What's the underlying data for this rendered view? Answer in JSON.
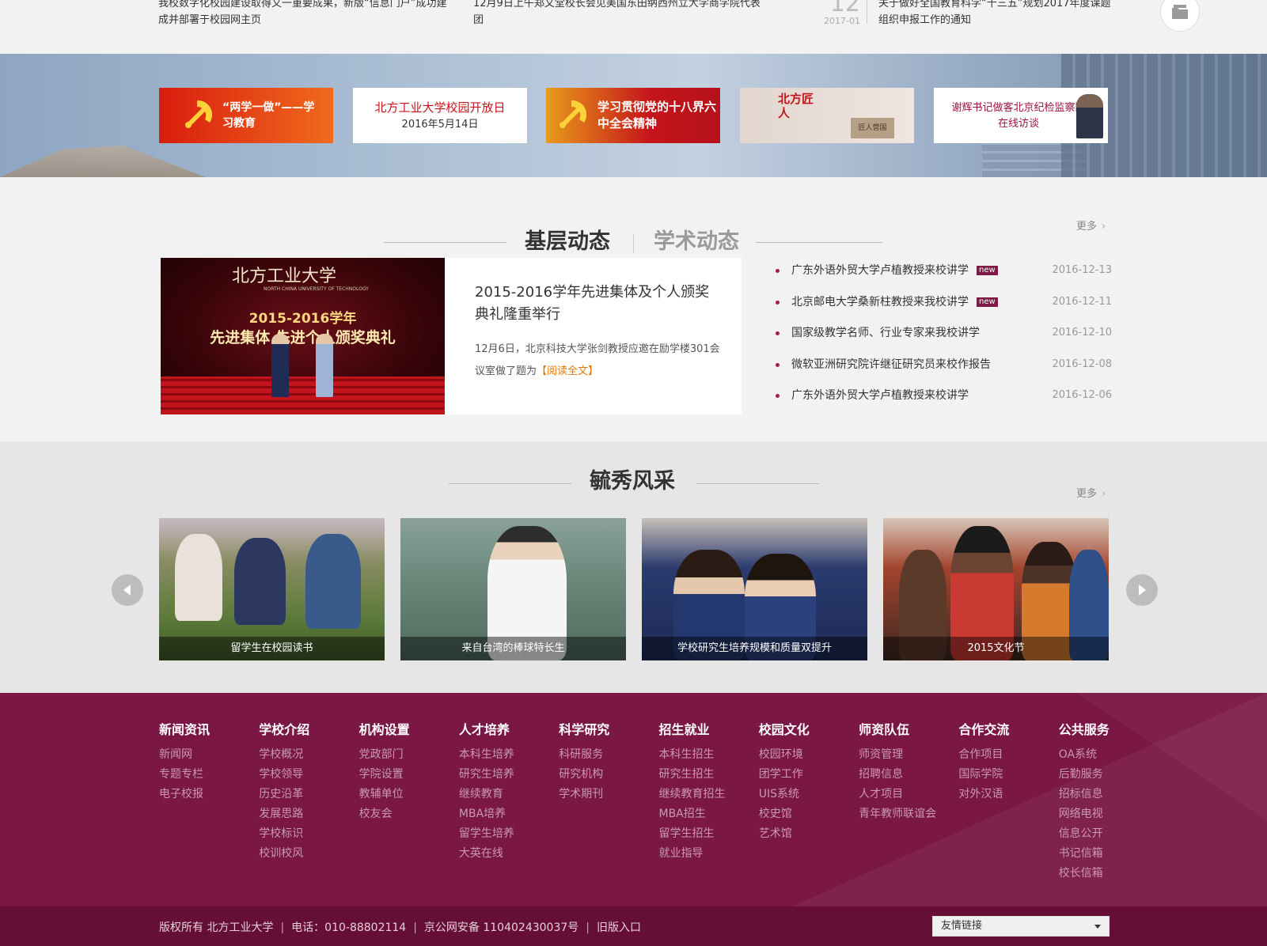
{
  "top_news": {
    "item1": "我校数字化校园建设取得又一重要成果，新版“信息门户”成功建成并部署于校园网主页",
    "item2": "12月9日上午郑文堂校长会见美国东田纳西州立大学商学院代表团",
    "date_day": "12",
    "date_ym": "2017-01",
    "item3": "关于做好全国教育科学“十三五”规划2017年度课题组织申报工作的通知"
  },
  "banners": [
    {
      "text": "“两学一做”——学习教育"
    },
    {
      "title": "北方工业大学校园开放日",
      "sub": "2016年5月14日"
    },
    {
      "text": "学习贯彻党的十八界六中全会精神"
    },
    {
      "text": "北方匠人",
      "stamp": "匠人营国"
    },
    {
      "text": "谢辉书记做客北京纪检监察网在线访谈"
    }
  ],
  "section1": {
    "tab_active": "基层动态",
    "tab_inactive": "学术动态",
    "more": "更多",
    "feature": {
      "image_uni": "北方工业大学",
      "image_uni_en": "NORTH CHINA UNIVERSITY OF TECHNOLOGY",
      "image_line1": "2015-2016学年",
      "image_line2": "先进集体  先进个人颁奖典礼",
      "title": "2015-2016学年先进集体及个人颁奖典礼隆重举行",
      "summary": "12月6日，北京科技大学张剑教授应邀在励学楼301会议室做了题为",
      "read_more": "【阅读全文】"
    },
    "news": [
      {
        "title": "广东外语外贸大学卢植教授来校讲学",
        "badge": "new",
        "date": "2016-12-13"
      },
      {
        "title": "北京邮电大学桑新柱教授来我校讲学",
        "badge": "new",
        "date": "2016-12-11"
      },
      {
        "title": "国家级教学名师、行业专家来我校讲学",
        "badge": "",
        "date": "2016-12-10"
      },
      {
        "title": "微软亚洲研究院许继征研究员来校作报告",
        "badge": "",
        "date": "2016-12-08"
      },
      {
        "title": "广东外语外贸大学卢植教授来校讲学",
        "badge": "",
        "date": "2016-12-06"
      }
    ]
  },
  "section2": {
    "title": "毓秀风采",
    "more": "更多",
    "photos": [
      {
        "caption": "留学生在校园读书"
      },
      {
        "caption": "来自台湾的棒球特长生"
      },
      {
        "caption": "学校研究生培养规模和质量双提升"
      },
      {
        "caption": "2015文化节"
      }
    ]
  },
  "footer": {
    "columns": [
      {
        "title": "新闻资讯",
        "links": [
          "新闻网",
          "专题专栏",
          "电子校报"
        ]
      },
      {
        "title": "学校介绍",
        "links": [
          "学校概况",
          "学校领导",
          "历史沿革",
          "发展思路",
          "学校标识",
          "校训校风"
        ]
      },
      {
        "title": "机构设置",
        "links": [
          "党政部门",
          "学院设置",
          "教辅单位",
          "校友会"
        ]
      },
      {
        "title": "人才培养",
        "links": [
          "本科生培养",
          "研究生培养",
          "继续教育",
          "MBA培养",
          "留学生培养",
          "大英在线"
        ]
      },
      {
        "title": "科学研究",
        "links": [
          "科研服务",
          "研究机构",
          "学术期刊"
        ]
      },
      {
        "title": "招生就业",
        "links": [
          "本科生招生",
          "研究生招生",
          "继续教育招生",
          "MBA招生",
          "留学生招生",
          "就业指导"
        ]
      },
      {
        "title": "校园文化",
        "links": [
          "校园环境",
          "团学工作",
          "UIS系统",
          "校史馆",
          "艺术馆"
        ]
      },
      {
        "title": "师资队伍",
        "links": [
          "师资管理",
          "招聘信息",
          "人才项目",
          "青年教师联谊会"
        ]
      },
      {
        "title": "合作交流",
        "links": [
          "合作项目",
          "国际学院",
          "对外汉语"
        ]
      },
      {
        "title": "公共服务",
        "links": [
          "OA系统",
          "后勤服务",
          "招标信息",
          "网络电视",
          "信息公开",
          "书记信箱",
          "校长信箱"
        ]
      }
    ],
    "copyright": "版权所有 北方工业大学",
    "phone": "电话：010-88802114",
    "icp": "京公网安备 110402430037号",
    "old_site": "旧版入口",
    "friend_links": "友情链接"
  },
  "colors": {
    "brand": "#7a1745",
    "accent": "#e2780c",
    "badge": "#7e1a45"
  }
}
